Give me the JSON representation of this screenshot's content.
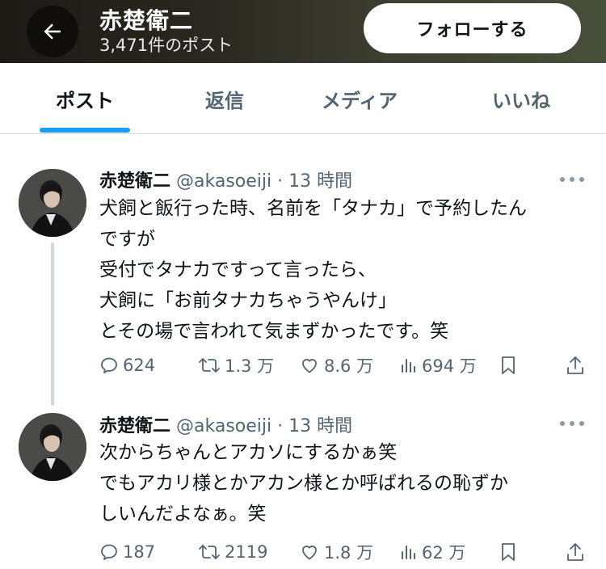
{
  "header": {
    "title": "赤楚衛二",
    "post_count": "3,471件のポスト",
    "follow_label": "フォローする",
    "background": "#2a2820"
  },
  "tabs": [
    {
      "label": "ポスト",
      "active": true
    },
    {
      "label": "返信",
      "active": false
    },
    {
      "label": "メディア",
      "active": false
    },
    {
      "label": "いいね",
      "active": false
    }
  ],
  "accent_color": "#1d9bf0",
  "tweets": [
    {
      "name": "赤楚衛二",
      "handle": "@akasoeiji",
      "separator": "·",
      "time": "13 時間",
      "lines": [
        "犬飼と飯行った時、名前を「タナカ」で予約したん",
        "ですが",
        "受付でタナカですって言ったら、",
        "犬飼に「お前タナカちゃうやんけ」",
        "とその場で言われて気まずかったです。笑"
      ],
      "replies": "624",
      "reposts": "1.3 万",
      "likes": "8.6 万",
      "views": "694 万"
    },
    {
      "name": "赤楚衛二",
      "handle": "@akasoeiji",
      "separator": "·",
      "time": "13 時間",
      "lines": [
        "次からちゃんとアカソにするかぁ笑",
        "でもアカリ様とかアカン様とか呼ばれるの恥ずか",
        "しいんだよなぁ。笑"
      ],
      "replies": "187",
      "reposts": "2119",
      "likes": "1.8 万",
      "views": "62 万"
    }
  ]
}
